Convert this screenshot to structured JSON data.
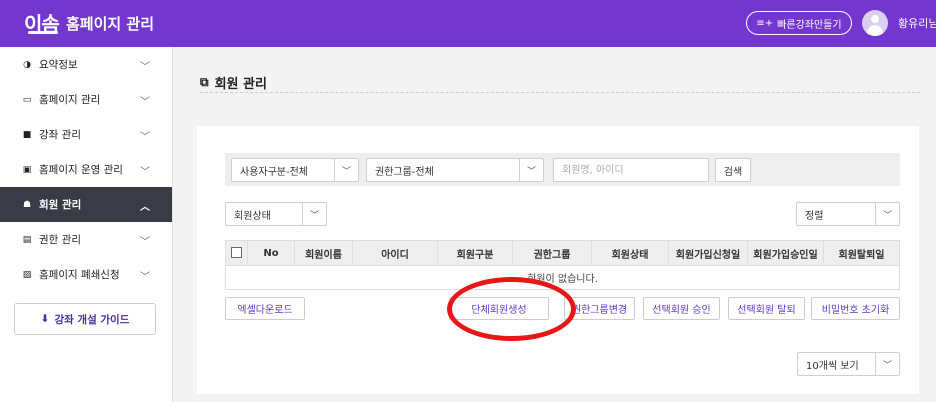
{
  "header": {
    "logo_text": "이솜",
    "app_title": "홈페이지 관리",
    "quick_button": "빠른강좌만들기",
    "user_name": "황유리님"
  },
  "sidebar": {
    "items": [
      {
        "label": "요약정보",
        "icon": "pie-chart-icon"
      },
      {
        "label": "홈페이지 관리",
        "icon": "window-icon"
      },
      {
        "label": "강좌 관리",
        "icon": "book-icon"
      },
      {
        "label": "홈페이지 운영 관리",
        "icon": "monitor-icon"
      },
      {
        "label": "회원 관리",
        "icon": "users-icon"
      },
      {
        "label": "권한 관리",
        "icon": "id-card-icon"
      },
      {
        "label": "홈페이지 폐쇄신청",
        "icon": "image-icon"
      }
    ],
    "guide_button": "강좌 개설 가이드"
  },
  "page": {
    "title": "회원 관리"
  },
  "filters": {
    "user_type": "사용자구분-전체",
    "auth_group": "권한그룹-전체",
    "search_placeholder": "회원명, 아이디",
    "search_button": "검색",
    "member_status": "회원상태",
    "sort": "정렬"
  },
  "table": {
    "columns": [
      "No",
      "회원이름",
      "아이디",
      "회원구분",
      "권한그룹",
      "회원상태",
      "회원가입신청일",
      "회원가입승인일",
      "회원탈퇴일"
    ],
    "empty_message": "회원이 없습니다."
  },
  "actions": {
    "excel_download": "엑셀다운로드",
    "bulk_create": "단체회원생성",
    "change_group": "권한그룹변경",
    "approve_selected": "선택회원 승인",
    "withdraw_selected": "선택회원 탈퇴",
    "reset_password": "비밀번호 초기화"
  },
  "pagination": {
    "page_size": "10개씩 보기"
  },
  "colors": {
    "brand": "#7336cf",
    "sidebar_active": "#3b3b45",
    "annotation": "#e81717"
  }
}
